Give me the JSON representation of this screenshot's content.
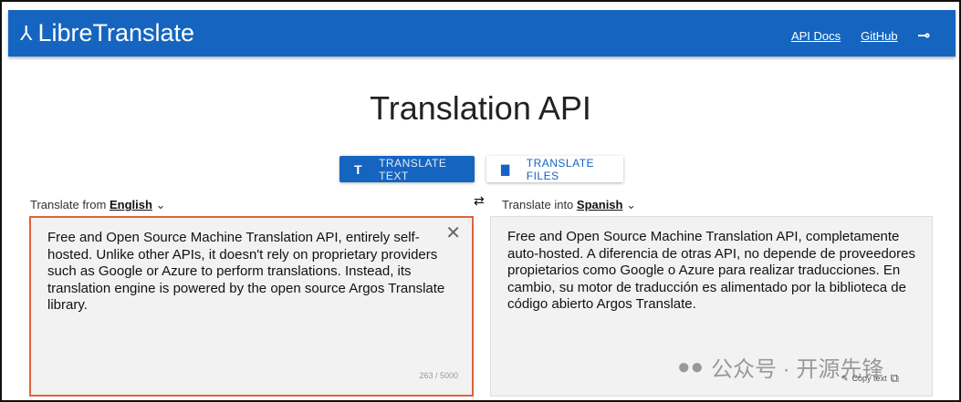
{
  "header": {
    "brand": "LibreTranslate",
    "links": [
      "API Docs",
      "GitHub"
    ]
  },
  "title": "Translation API",
  "tabs": {
    "text": "TRANSLATE TEXT",
    "files": "TRANSLATE FILES"
  },
  "source": {
    "label": "Translate from",
    "lang": "English",
    "text": "Free and Open Source Machine Translation API, entirely self-hosted. Unlike other APIs, it doesn't rely on proprietary providers such as Google or Azure to perform translations. Instead, its translation engine is powered by the open source Argos Translate library.",
    "count": "263 / 5000"
  },
  "target": {
    "label": "Translate into",
    "lang": "Spanish",
    "text": "Free and Open Source Machine Translation API, completamente auto-hosted. A diferencia de otras API, no depende de proveedores propietarios como Google o Azure para realizar traducciones. En cambio, su motor de traducción es alimentado por la biblioteca de código abierto Argos Translate.",
    "copy": "Copy text"
  },
  "watermark": "公众号 · 开源先锋"
}
